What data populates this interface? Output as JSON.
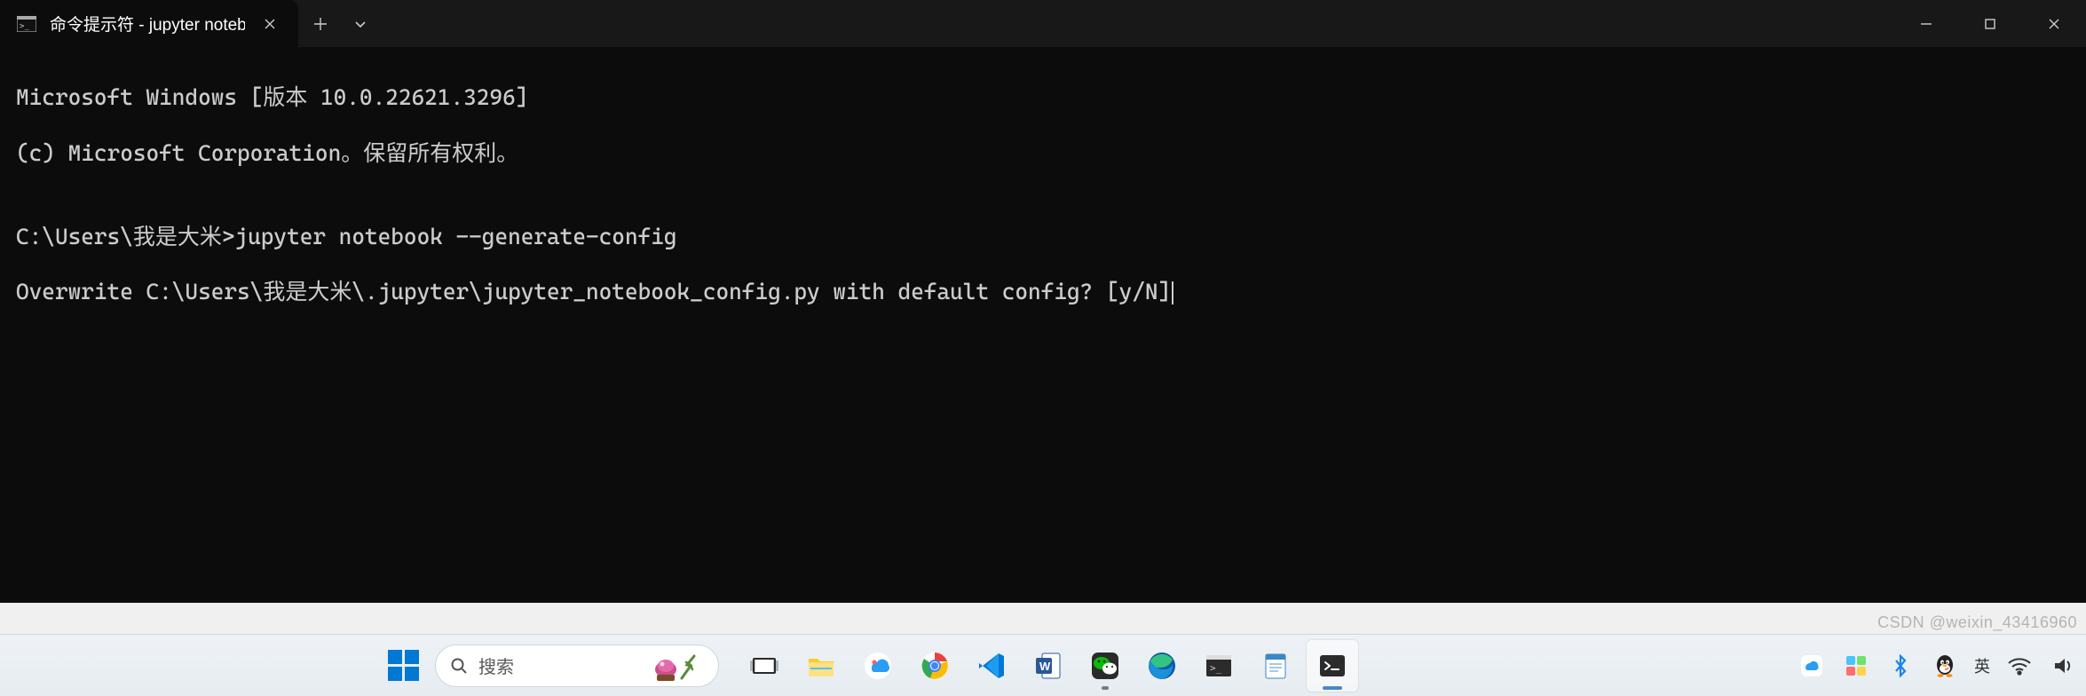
{
  "window": {
    "tab_title": "命令提示符 - jupyter  noteboo",
    "tabs": {
      "new_tab_tooltip": "New tab",
      "dropdown_tooltip": "New tab dropdown"
    },
    "controls": {
      "minimize": "Minimize",
      "maximize": "Maximize",
      "close": "Close"
    }
  },
  "terminal": {
    "line1": "Microsoft Windows [版本 10.0.22621.3296]",
    "line2": "(c) Microsoft Corporation。保留所有权利。",
    "blank": "",
    "prompt_line": "C:\\Users\\我是大米>jupyter notebook --generate-config",
    "overwrite_line": "Overwrite C:\\Users\\我是大米\\.jupyter\\jupyter_notebook_config.py with default config? [y/N]"
  },
  "taskbar": {
    "search_placeholder": "搜索",
    "icons": {
      "start": "start",
      "task_view": "task-view",
      "file_explorer": "file-explorer",
      "baidu": "baidu-netdisk",
      "chrome": "chrome",
      "vscode": "vscode",
      "word": "word",
      "wechat": "wechat",
      "edge": "edge",
      "cmd": "command-prompt",
      "notepad": "notepad",
      "terminal": "terminal"
    },
    "tray": {
      "cloud": "baidu-sync",
      "widgets": "widgets",
      "bluetooth": "bluetooth",
      "qq": "qq",
      "ime": "英",
      "wifi": "wifi",
      "volume": "volume"
    }
  },
  "watermark": "CSDN @weixin_43416960"
}
